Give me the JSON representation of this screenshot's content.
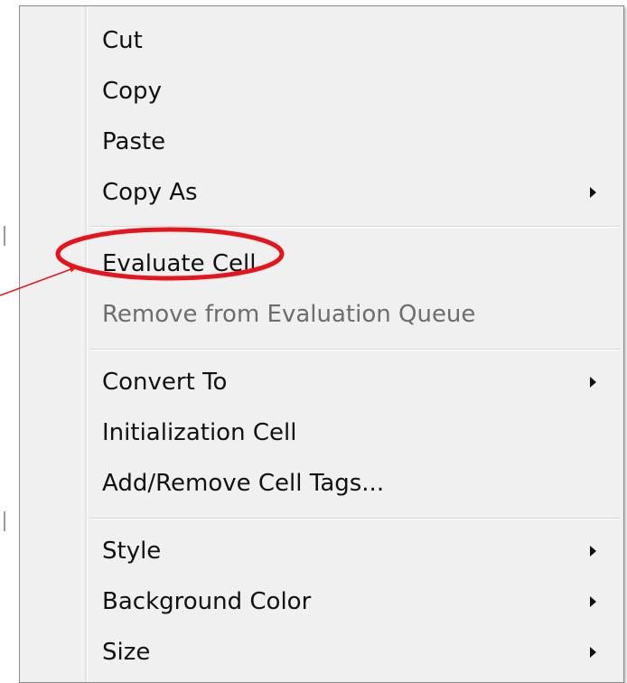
{
  "background": {
    "glyph": "ㅏ"
  },
  "menu": {
    "groups": [
      {
        "items": [
          {
            "label": "Cut",
            "name": "menu-item-cut",
            "enabled": true,
            "submenu": false
          },
          {
            "label": "Copy",
            "name": "menu-item-copy",
            "enabled": true,
            "submenu": false
          },
          {
            "label": "Paste",
            "name": "menu-item-paste",
            "enabled": true,
            "submenu": false
          },
          {
            "label": "Copy As",
            "name": "menu-item-copy-as",
            "enabled": true,
            "submenu": true
          }
        ]
      },
      {
        "items": [
          {
            "label": "Evaluate Cell",
            "name": "menu-item-evaluate-cell",
            "enabled": true,
            "submenu": false
          },
          {
            "label": "Remove from Evaluation Queue",
            "name": "menu-item-remove-from-evaluation-queue",
            "enabled": false,
            "submenu": false
          }
        ]
      },
      {
        "items": [
          {
            "label": "Convert To",
            "name": "menu-item-convert-to",
            "enabled": true,
            "submenu": true
          },
          {
            "label": "Initialization Cell",
            "name": "menu-item-initialization-cell",
            "enabled": true,
            "submenu": false
          },
          {
            "label": "Add/Remove Cell Tags...",
            "name": "menu-item-add-remove-cell-tags",
            "enabled": true,
            "submenu": false
          }
        ]
      },
      {
        "items": [
          {
            "label": "Style",
            "name": "menu-item-style",
            "enabled": true,
            "submenu": true
          },
          {
            "label": "Background Color",
            "name": "menu-item-background-color",
            "enabled": true,
            "submenu": true
          },
          {
            "label": "Size",
            "name": "menu-item-size",
            "enabled": true,
            "submenu": true
          }
        ]
      }
    ]
  },
  "annotation": {
    "highlighted_item": "Evaluate Cell",
    "color": "#e8141b"
  }
}
